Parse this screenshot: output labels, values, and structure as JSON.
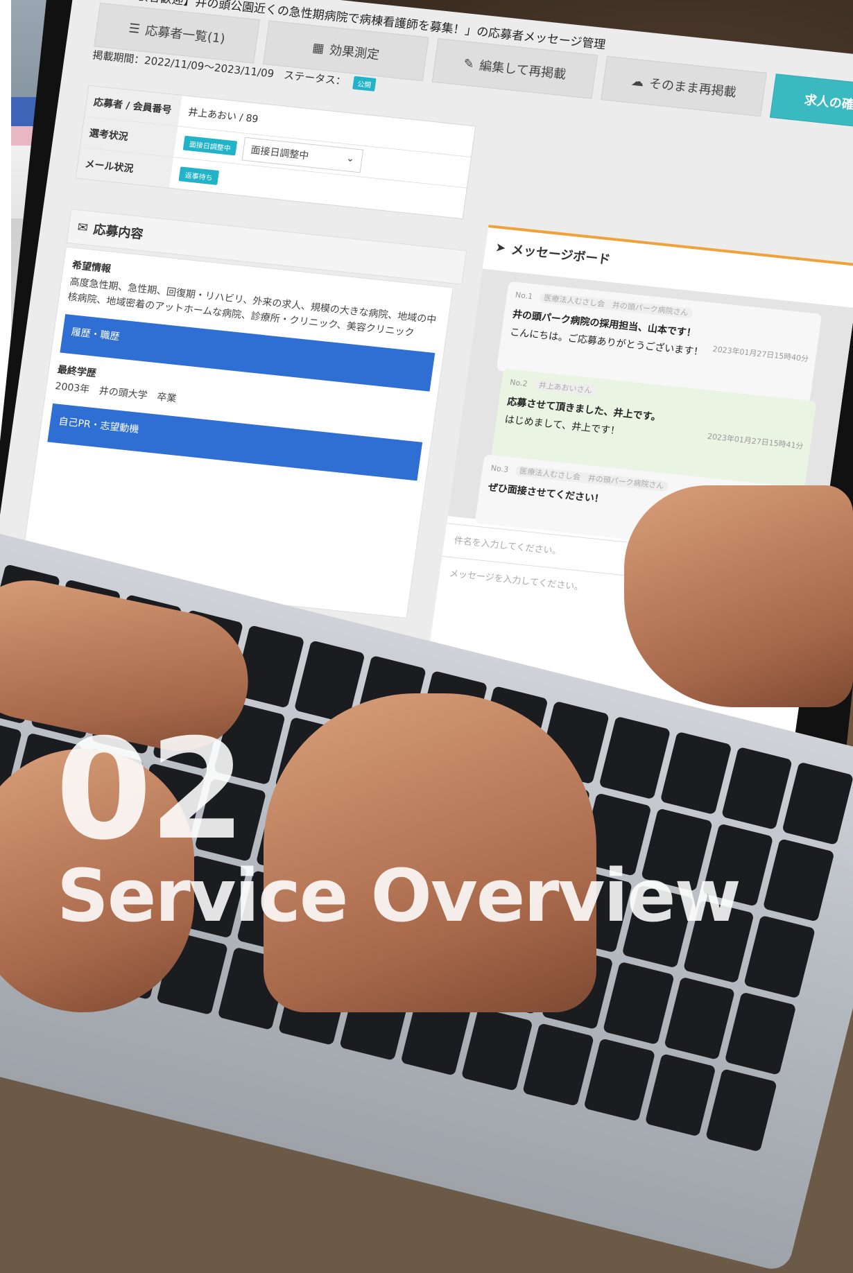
{
  "job": {
    "title": "【未経験者歓迎】井の頭公園近くの急性期病院で病棟看護師を募集！」の応募者メッセージ管理",
    "period": "掲載期間：2022/11/09〜2023/11/09",
    "status_label": "ステータス：",
    "status_badge": "公開"
  },
  "tabs": {
    "applicants": "応募者一覧(1)",
    "effect": "効果測定",
    "edit_repost": "編集して再掲載",
    "repost": "そのまま再掲載",
    "confirm": "求人の確認"
  },
  "applicant": {
    "label_member": "応募者 / 会員番号",
    "member_value": "井上あおい / 89",
    "label_selection": "選考状況",
    "selection_chip": "面接日調整中",
    "selection_select": "面接日調整中",
    "label_mail": "メール状況",
    "mail_chip": "返事待ち"
  },
  "application": {
    "heading": "応募内容",
    "wish_label": "希望情報",
    "wish_text": "高度急性期、急性期、回復期・リハビリ、外来の求人、規模の大きな病院、地域の中核病院、地域密着のアットホームな病院、診療所・クリニック、美容クリニック",
    "resume_bar": "履歴・職歴",
    "edu_label": "最終学歴",
    "edu_text": "2003年　井の頭大学　卒業",
    "pr_bar": "自己PR・志望動機"
  },
  "messages": {
    "heading": "メッセージボード",
    "items": [
      {
        "no": "No.1",
        "who": "医療法人むさし会　井の頭パーク病院さん",
        "headline": "井の頭パーク病院の採用担当、山本です！",
        "time": "2023年01月27日15時40分",
        "body": "こんにちは。ご応募ありがとうございます！"
      },
      {
        "no": "No.2",
        "who": "井上あおいさん",
        "headline": "応募させて頂きました、井上です。",
        "time": "2023年01月27日15時41分",
        "body": "はじめまして、井上です！"
      },
      {
        "no": "No.3",
        "who": "医療法人むさし会　井の頭パーク病院さん",
        "headline": "ぜひ面接させてください！",
        "time": "",
        "body": ""
      }
    ],
    "subject_placeholder": "件名を入力してください。",
    "message_placeholder": "メッセージを入力してください。"
  },
  "overlay": {
    "number": "02",
    "title": "Service Overview"
  },
  "colors": {
    "accent_teal": "#3bb9c1",
    "blue_bar": "#2f6fd3",
    "board_orange": "#f0a23a"
  }
}
